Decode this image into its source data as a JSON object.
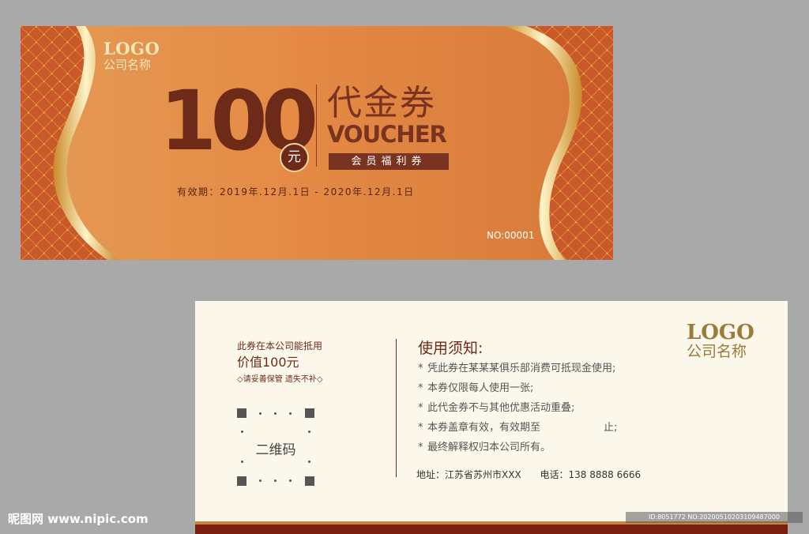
{
  "front": {
    "logo_word": "LOGO",
    "logo_company": "公司名称",
    "amount": "100",
    "yuan": "元",
    "title_cn": "代金券",
    "title_en": "VOUCHER",
    "member_tag": "会员福利券",
    "validity": "有效期：2019年.12月.1日 - 2020年.12月.1日",
    "serial": "NO:00001"
  },
  "back": {
    "line1": "此券在本公司能抵用",
    "line2": "价值100元",
    "line3": "◇请妥善保管 遗失不补◇",
    "qr_label": "二维码",
    "notes_title": "使用须知:",
    "bullet": "*",
    "notes": [
      "凭此券在某某某俱乐部消费可抵现金使用;",
      "本券仅限每人使用一张;",
      "此代金券不与其他优惠活动重叠;",
      "本券盖章有效，有效期至",
      "最终解释权归本公司所有。"
    ],
    "note4_suffix": "止;",
    "address": "地址：江苏省苏州市XXX",
    "phone": "电话：138 8888 6666",
    "logo_word": "LOGO",
    "logo_company": "公司名称"
  },
  "watermark": {
    "left": "昵图网 www.nipic.com",
    "right": "ID:8051772 NO:20200510203109487000"
  },
  "colors": {
    "front_orange": "#e58b45",
    "brown": "#6e2a19",
    "gold": "#f3d19b",
    "back_bg": "#fbf8eb"
  }
}
